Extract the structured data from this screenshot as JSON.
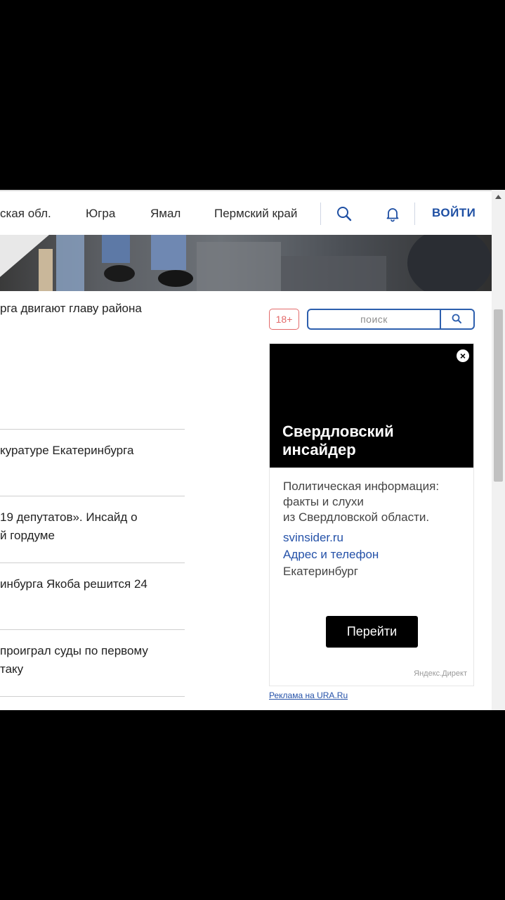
{
  "nav": {
    "items": [
      {
        "label": "ская обл."
      },
      {
        "label": "Югра"
      },
      {
        "label": "Ямал"
      },
      {
        "label": "Пермский край"
      }
    ],
    "login_label": "ВОЙТИ"
  },
  "news": [
    {
      "title": "рга двигают главу района"
    },
    {
      "title": "куратуре Екатеринбурга"
    },
    {
      "title": "19 депутатов». Инсайд о\nй гордуме"
    },
    {
      "title": "инбурга Якоба решится 24"
    },
    {
      "title": "проиграл суды по первому\nтаку"
    }
  ],
  "sidebar": {
    "age_rating": "18+",
    "search_placeholder": "поиск",
    "ad": {
      "title": "Свердловский\nинсайдер",
      "description": "Политическая информация:\nфакты и слухи\nиз Свердловской области.",
      "link": "svinsider.ru",
      "contacts": "Адрес и телефон",
      "city": "Екатеринбург",
      "cta": "Перейти",
      "source": "Яндекс.Директ",
      "close": "×"
    },
    "ad_footer": "Реклама на URA.Ru"
  },
  "colors": {
    "accent": "#1e4fa3",
    "age_badge": "#e36a6a",
    "background": "#000000"
  }
}
